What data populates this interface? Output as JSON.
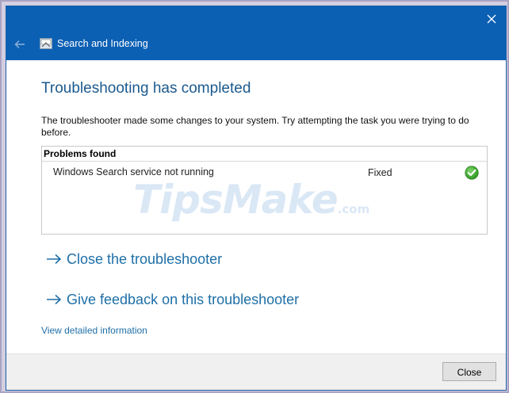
{
  "window": {
    "title": "Search and Indexing",
    "accent_color": "#0b60b4",
    "icons": [
      "close-icon",
      "back-arrow-icon",
      "search-indexing-app-icon"
    ]
  },
  "content": {
    "heading": "Troubleshooting has completed",
    "description": "The troubleshooter made some changes to your system. Try attempting the task you were trying to do before."
  },
  "problems": {
    "header": "Problems found",
    "items": [
      {
        "name": "Windows Search service not running",
        "status": "Fixed",
        "status_icon": "green-check-icon"
      }
    ]
  },
  "links": {
    "close_troubleshooter": "Close the troubleshooter",
    "give_feedback": "Give feedback on this troubleshooter",
    "view_details": "View detailed information"
  },
  "footer": {
    "close_button": "Close"
  },
  "watermark": {
    "text": "TipsMake",
    "suffix": ".com"
  }
}
